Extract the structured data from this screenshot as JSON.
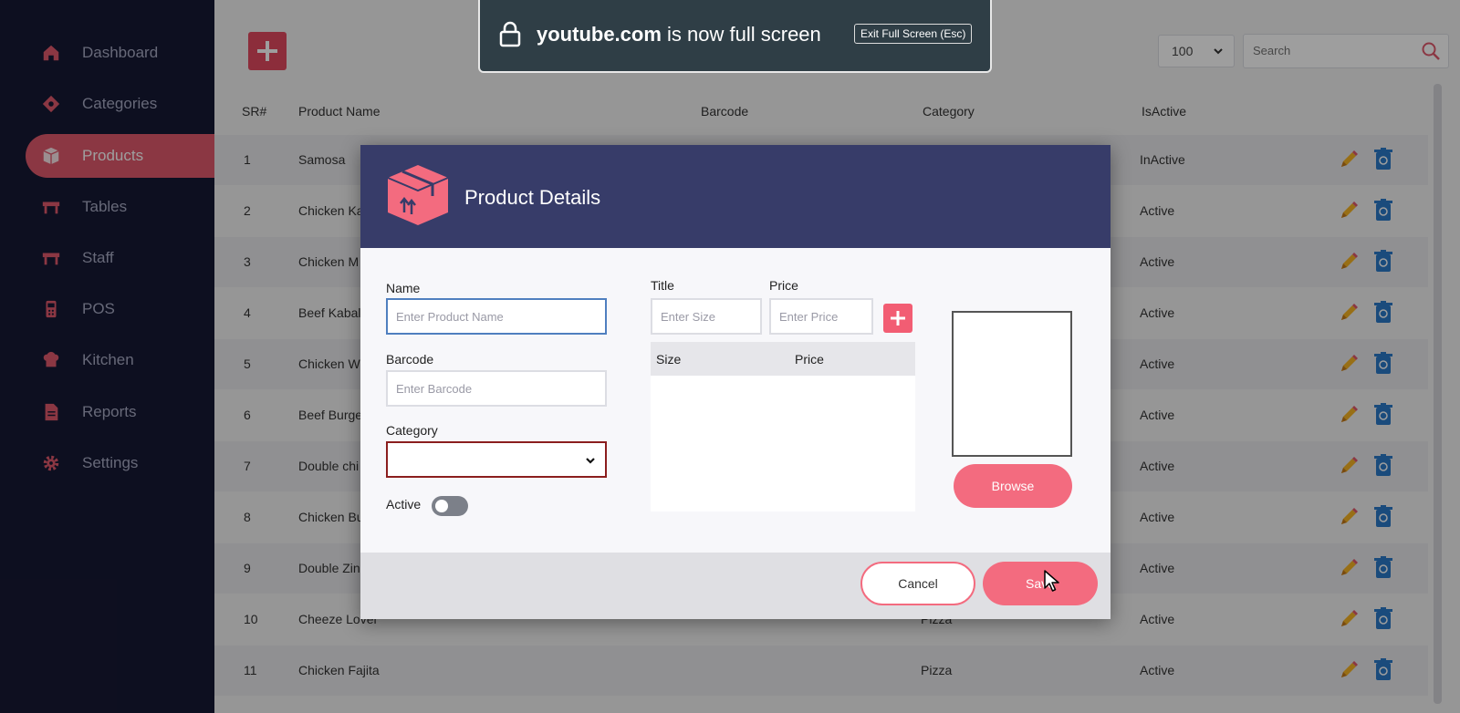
{
  "sidebar": {
    "items": [
      {
        "label": "Dashboard",
        "icon": "home-icon"
      },
      {
        "label": "Categories",
        "icon": "tag-icon"
      },
      {
        "label": "Products",
        "icon": "box-icon",
        "active": true
      },
      {
        "label": "Tables",
        "icon": "table-icon"
      },
      {
        "label": "Staff",
        "icon": "staff-icon"
      },
      {
        "label": "POS",
        "icon": "pos-icon"
      },
      {
        "label": "Kitchen",
        "icon": "chef-hat-icon"
      },
      {
        "label": "Reports",
        "icon": "report-icon"
      },
      {
        "label": "Settings",
        "icon": "gear-icon"
      }
    ]
  },
  "toolbar": {
    "page_size": "100",
    "search_placeholder": "Search"
  },
  "table": {
    "headers": {
      "sr": "SR#",
      "name": "Product Name",
      "barcode": "Barcode",
      "category": "Category",
      "isactive": "IsActive"
    },
    "rows": [
      {
        "sr": "1",
        "name": "Samosa",
        "category": "",
        "status": "InActive"
      },
      {
        "sr": "2",
        "name": "Chicken Ka",
        "category": "",
        "status": "Active"
      },
      {
        "sr": "3",
        "name": "Chicken M",
        "category": "",
        "status": "Active"
      },
      {
        "sr": "4",
        "name": "Beef Kabal",
        "category": "",
        "status": "Active"
      },
      {
        "sr": "5",
        "name": "Chicken W",
        "category": "",
        "status": "Active"
      },
      {
        "sr": "6",
        "name": "Beef Burge",
        "category": "",
        "status": "Active"
      },
      {
        "sr": "7",
        "name": "Double chi",
        "category": "",
        "status": "Active"
      },
      {
        "sr": "8",
        "name": "Chicken Bu",
        "category": "",
        "status": "Active"
      },
      {
        "sr": "9",
        "name": "Double Zin",
        "category": "",
        "status": "Active"
      },
      {
        "sr": "10",
        "name": "Cheeze Lover",
        "category": "Pizza",
        "status": "Active"
      },
      {
        "sr": "11",
        "name": "Chicken Fajita",
        "category": "Pizza",
        "status": "Active"
      }
    ]
  },
  "modal": {
    "title": "Product Details",
    "name_label": "Name",
    "name_placeholder": "Enter Product Name",
    "barcode_label": "Barcode",
    "barcode_placeholder": "Enter Barcode",
    "category_label": "Category",
    "category_value": "",
    "active_label": "Active",
    "active_on": false,
    "title_label": "Title",
    "size_placeholder": "Enter Size",
    "price_label": "Price",
    "price_placeholder": "Enter Price",
    "size_table_headers": {
      "size": "Size",
      "price": "Price"
    },
    "browse_label": "Browse",
    "cancel_label": "Cancel",
    "save_label": "Save"
  },
  "fullscreen_notice": {
    "site": "youtube.com",
    "message": "is now full screen",
    "exit_label": "Exit Full Screen (Esc)"
  },
  "colors": {
    "sidebar_bg": "#161934",
    "accent": "#f36b7f",
    "add_button": "#e24a5f",
    "modal_header": "#373c69"
  }
}
